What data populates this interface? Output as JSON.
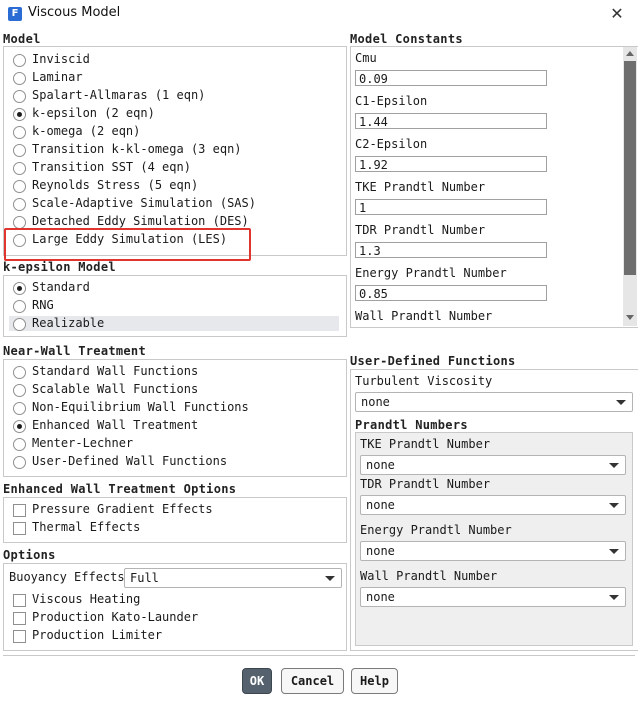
{
  "window": {
    "title": "Viscous Model",
    "app_icon_letter": "F",
    "close_glyph": "✕"
  },
  "model": {
    "title": "Model",
    "options": [
      {
        "label": "Inviscid",
        "selected": false
      },
      {
        "label": "Laminar",
        "selected": false
      },
      {
        "label": "Spalart-Allmaras (1 eqn)",
        "selected": false
      },
      {
        "label": "k-epsilon (2 eqn)",
        "selected": true
      },
      {
        "label": "k-omega (2 eqn)",
        "selected": false
      },
      {
        "label": "Transition k-kl-omega (3 eqn)",
        "selected": false
      },
      {
        "label": "Transition SST (4 eqn)",
        "selected": false
      },
      {
        "label": "Reynolds Stress (5 eqn)",
        "selected": false
      },
      {
        "label": "Scale-Adaptive Simulation (SAS)",
        "selected": false
      },
      {
        "label": "Detached Eddy Simulation (DES)",
        "selected": false
      },
      {
        "label": "Large Eddy Simulation (LES)",
        "selected": false,
        "highlighted": true
      }
    ]
  },
  "kepsilon": {
    "title": "k-epsilon Model",
    "options": [
      {
        "label": "Standard",
        "selected": true
      },
      {
        "label": "RNG",
        "selected": false
      },
      {
        "label": "Realizable",
        "selected": false
      }
    ]
  },
  "near_wall": {
    "title": "Near-Wall Treatment",
    "options": [
      {
        "label": "Standard Wall Functions",
        "selected": false
      },
      {
        "label": "Scalable Wall Functions",
        "selected": false
      },
      {
        "label": "Non-Equilibrium Wall Functions",
        "selected": false
      },
      {
        "label": "Enhanced Wall Treatment",
        "selected": true
      },
      {
        "label": "Menter-Lechner",
        "selected": false
      },
      {
        "label": "User-Defined Wall Functions",
        "selected": false
      }
    ]
  },
  "ewt_options": {
    "title": "Enhanced Wall Treatment Options",
    "checks": [
      {
        "label": "Pressure Gradient Effects",
        "checked": false
      },
      {
        "label": "Thermal Effects",
        "checked": false
      }
    ]
  },
  "options": {
    "title": "Options",
    "buoyancy_label": "Buoyancy Effects",
    "buoyancy_value": "Full",
    "checks": [
      {
        "label": "Viscous Heating",
        "checked": false
      },
      {
        "label": "Production Kato-Launder",
        "checked": false
      },
      {
        "label": "Production Limiter",
        "checked": false
      }
    ]
  },
  "constants": {
    "title": "Model Constants",
    "items": [
      {
        "label": "Cmu",
        "value": "0.09"
      },
      {
        "label": "C1-Epsilon",
        "value": "1.44"
      },
      {
        "label": "C2-Epsilon",
        "value": "1.92"
      },
      {
        "label": "TKE Prandtl Number",
        "value": "1"
      },
      {
        "label": "TDR Prandtl Number",
        "value": "1.3"
      },
      {
        "label": "Energy Prandtl Number",
        "value": "0.85"
      },
      {
        "label": "Wall Prandtl Number",
        "value": ""
      }
    ]
  },
  "udf": {
    "title": "User-Defined Functions",
    "turbulent_viscosity_label": "Turbulent Viscosity",
    "turbulent_viscosity_value": "none",
    "prandtl_title": "Prandtl Numbers",
    "prandtl_items": [
      {
        "label": "TKE Prandtl Number",
        "value": "none"
      },
      {
        "label": "TDR Prandtl Number",
        "value": "none"
      },
      {
        "label": "Energy Prandtl Number",
        "value": "none"
      },
      {
        "label": "Wall Prandtl Number",
        "value": "none"
      }
    ]
  },
  "buttons": {
    "ok": "OK",
    "cancel": "Cancel",
    "help": "Help"
  },
  "colors": {
    "highlight": "#e0352f",
    "ok_button": "#55626e"
  }
}
